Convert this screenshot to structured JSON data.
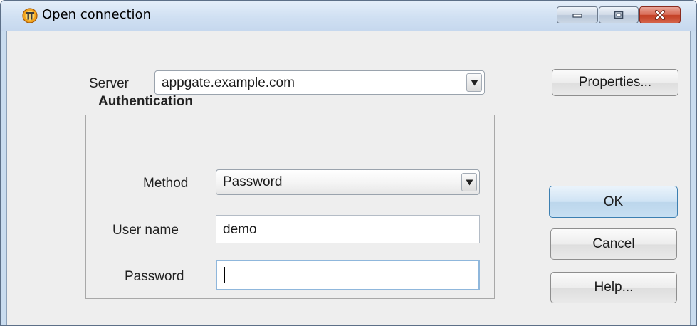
{
  "window": {
    "title": "Open connection",
    "app_icon": "appgate-logo-icon",
    "controls": [
      "minimize-icon",
      "maximize-icon",
      "close-icon"
    ]
  },
  "server": {
    "label": "Server",
    "value": "appgate.example.com",
    "properties_label": "Properties..."
  },
  "auth": {
    "group_title": "Authentication",
    "method_label": "Method",
    "method_value": "Password",
    "username_label": "User name",
    "username_value": "demo",
    "password_label": "Password",
    "password_value": ""
  },
  "buttons": {
    "ok": "OK",
    "cancel": "Cancel",
    "help": "Help..."
  },
  "colors": {
    "close_button": "#c8432a",
    "default_button": "#c7dff2",
    "focus_border": "#8fb7dc"
  }
}
